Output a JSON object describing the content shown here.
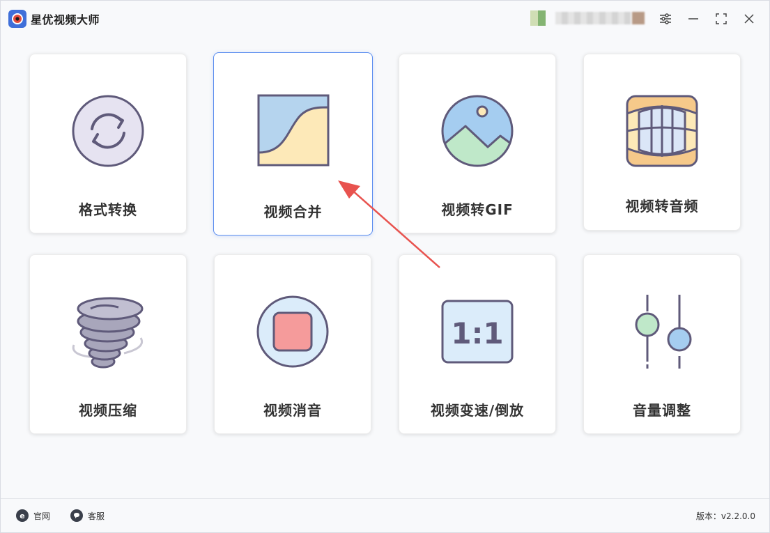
{
  "app": {
    "title": "星优视频大师",
    "version_label": "版本：v2.2.0.0"
  },
  "titlebar": {
    "settings_icon": "sliders-icon",
    "minimize_icon": "minimize-icon",
    "maximize_icon": "maximize-icon",
    "close_icon": "close-icon"
  },
  "cards": [
    {
      "label": "格式转换",
      "icon": "convert-icon"
    },
    {
      "label": "视频合并",
      "icon": "merge-icon"
    },
    {
      "label": "视频转GIF",
      "icon": "gif-image-icon"
    },
    {
      "label": "视频转音频",
      "icon": "audio-icon"
    },
    {
      "label": "视频压缩",
      "icon": "tornado-compress-icon"
    },
    {
      "label": "视频消音",
      "icon": "mute-icon"
    },
    {
      "label": "视频变速/倒放",
      "icon": "ratio-icon"
    },
    {
      "label": "音量调整",
      "icon": "volume-slider-icon"
    }
  ],
  "footer": {
    "website_label": "官网",
    "support_label": "客服"
  },
  "colors": {
    "accent": "#5b8def",
    "arrow": "#e8534f",
    "icon_stroke": "#5f5a7a"
  }
}
